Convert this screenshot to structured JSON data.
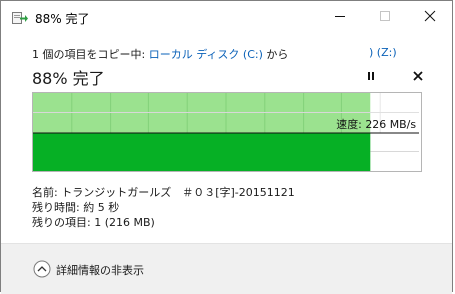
{
  "window": {
    "title": "88% 完了",
    "icon": "file-copy-icon"
  },
  "copy": {
    "prefix": "1 個の項目をコピー中: ",
    "source": "ローカル ディスク (C:)",
    "middle": " から",
    "destination": ") (Z:)",
    "progress_title": "88% 完了",
    "percent": 0.88,
    "speed_label": "速度: 226 MB/s"
  },
  "details": {
    "name_label": "名前:",
    "name_value": "トランジットガールズ　＃０３[字]-20151121",
    "time_label": "残り時間:",
    "time_value": "約 5 秒",
    "items_label": "残りの項目:",
    "items_value": "1 (216 MB)"
  },
  "footer": {
    "toggle_label": "詳細情報の非表示"
  },
  "colors": {
    "transferred": "#06b025",
    "graph_fill": "#9be28f",
    "grid": "#83d17a",
    "link": "#0a61b8"
  }
}
